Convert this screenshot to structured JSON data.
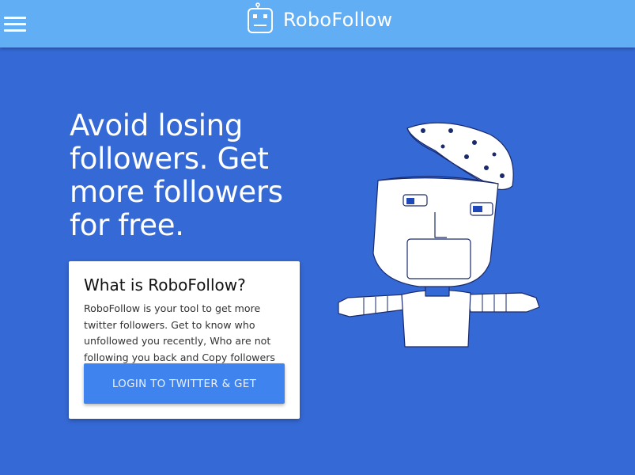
{
  "header": {
    "brand_name": "RoboFollow",
    "logo_icon": "robot-head-icon",
    "menu_icon": "hamburger-menu-icon"
  },
  "hero": {
    "headline": "Avoid losing followers. Get more followers for free.",
    "illustration_icon": "robot-illustration"
  },
  "card": {
    "title": "What is RoboFollow?",
    "description": "RoboFollow is your tool to get more twitter followers. Get to know who unfollowed you recently, Who are not following you back and Copy followers of your competitors.",
    "button_label": "LOGIN TO TWITTER & GET"
  },
  "colors": {
    "background": "#3569d6",
    "topbar": "#62aef5",
    "button": "#3f84ee",
    "card": "#ffffff"
  }
}
